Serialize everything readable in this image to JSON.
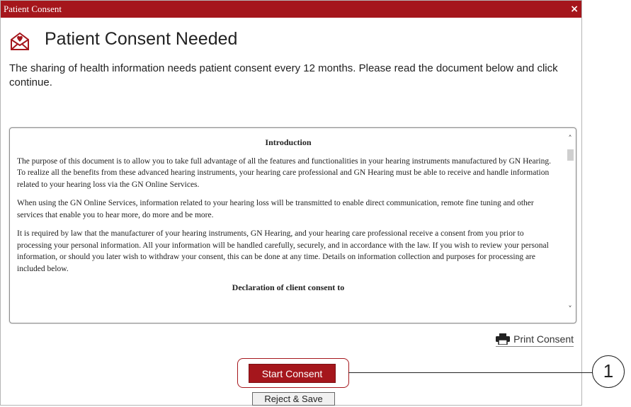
{
  "window": {
    "title": "Patient Consent",
    "close_glyph": "×"
  },
  "header": {
    "icon": "envelope-heart-icon",
    "heading": "Patient Consent Needed"
  },
  "intro_text": "The sharing of health information needs patient consent every 12 months. Please read the document below and click continue.",
  "document": {
    "section_title": "Introduction",
    "paragraphs": [
      "The purpose of this document is to allow you to take full advantage of all the features and functionalities in your hearing instruments manufactured by GN Hearing. To realize all the benefits from these advanced hearing instruments, your hearing care professional and GN Hearing must be able to receive and handle information related to your hearing loss via the GN Online Services.",
      "When using the GN Online Services, information related to your hearing loss will be transmitted to enable direct communication, remote fine tuning and other services that enable you to hear more, do more and be more.",
      "It is required by law that the manufacturer of your hearing instruments, GN Hearing, and your hearing care professional receive a consent from you prior to processing your personal information. All your information will be handled carefully, securely, and in accordance with the law. If you wish to review your personal information, or should you later wish to withdraw your consent, this can be done at any time. Details on information collection and purposes for processing are included below."
    ],
    "next_heading": "Declaration of client consent to",
    "scroll_up_glyph": "˄",
    "scroll_down_glyph": "˅"
  },
  "print_label": "Print Consent",
  "start_label": "Start Consent",
  "reject_label": "Reject & Save",
  "callout_number": "1",
  "colors": {
    "brand": "#a5161c"
  }
}
